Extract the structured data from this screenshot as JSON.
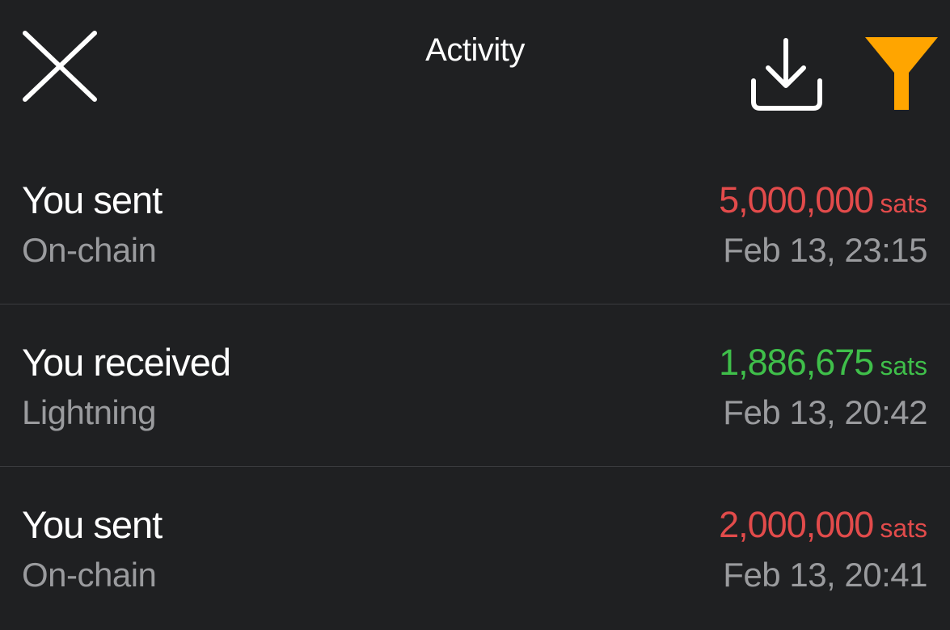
{
  "header": {
    "title": "Activity",
    "close_icon": "close-icon",
    "download_icon": "download-icon",
    "filter_icon": "filter-icon",
    "filter_color": "#ffa500"
  },
  "colors": {
    "background": "#1f2022",
    "sent_amount": "#e24b4b",
    "received_amount": "#3fbf4a",
    "secondary_text": "#9a9b9e"
  },
  "activity": [
    {
      "title": "You sent",
      "method": "On-chain",
      "amount": "5,000,000",
      "unit": "sats",
      "direction": "sent",
      "timestamp": "Feb 13, 23:15"
    },
    {
      "title": "You received",
      "method": "Lightning",
      "amount": "1,886,675",
      "unit": "sats",
      "direction": "received",
      "timestamp": "Feb 13, 20:42"
    },
    {
      "title": "You sent",
      "method": "On-chain",
      "amount": "2,000,000",
      "unit": "sats",
      "direction": "sent",
      "timestamp": "Feb 13, 20:41"
    }
  ]
}
